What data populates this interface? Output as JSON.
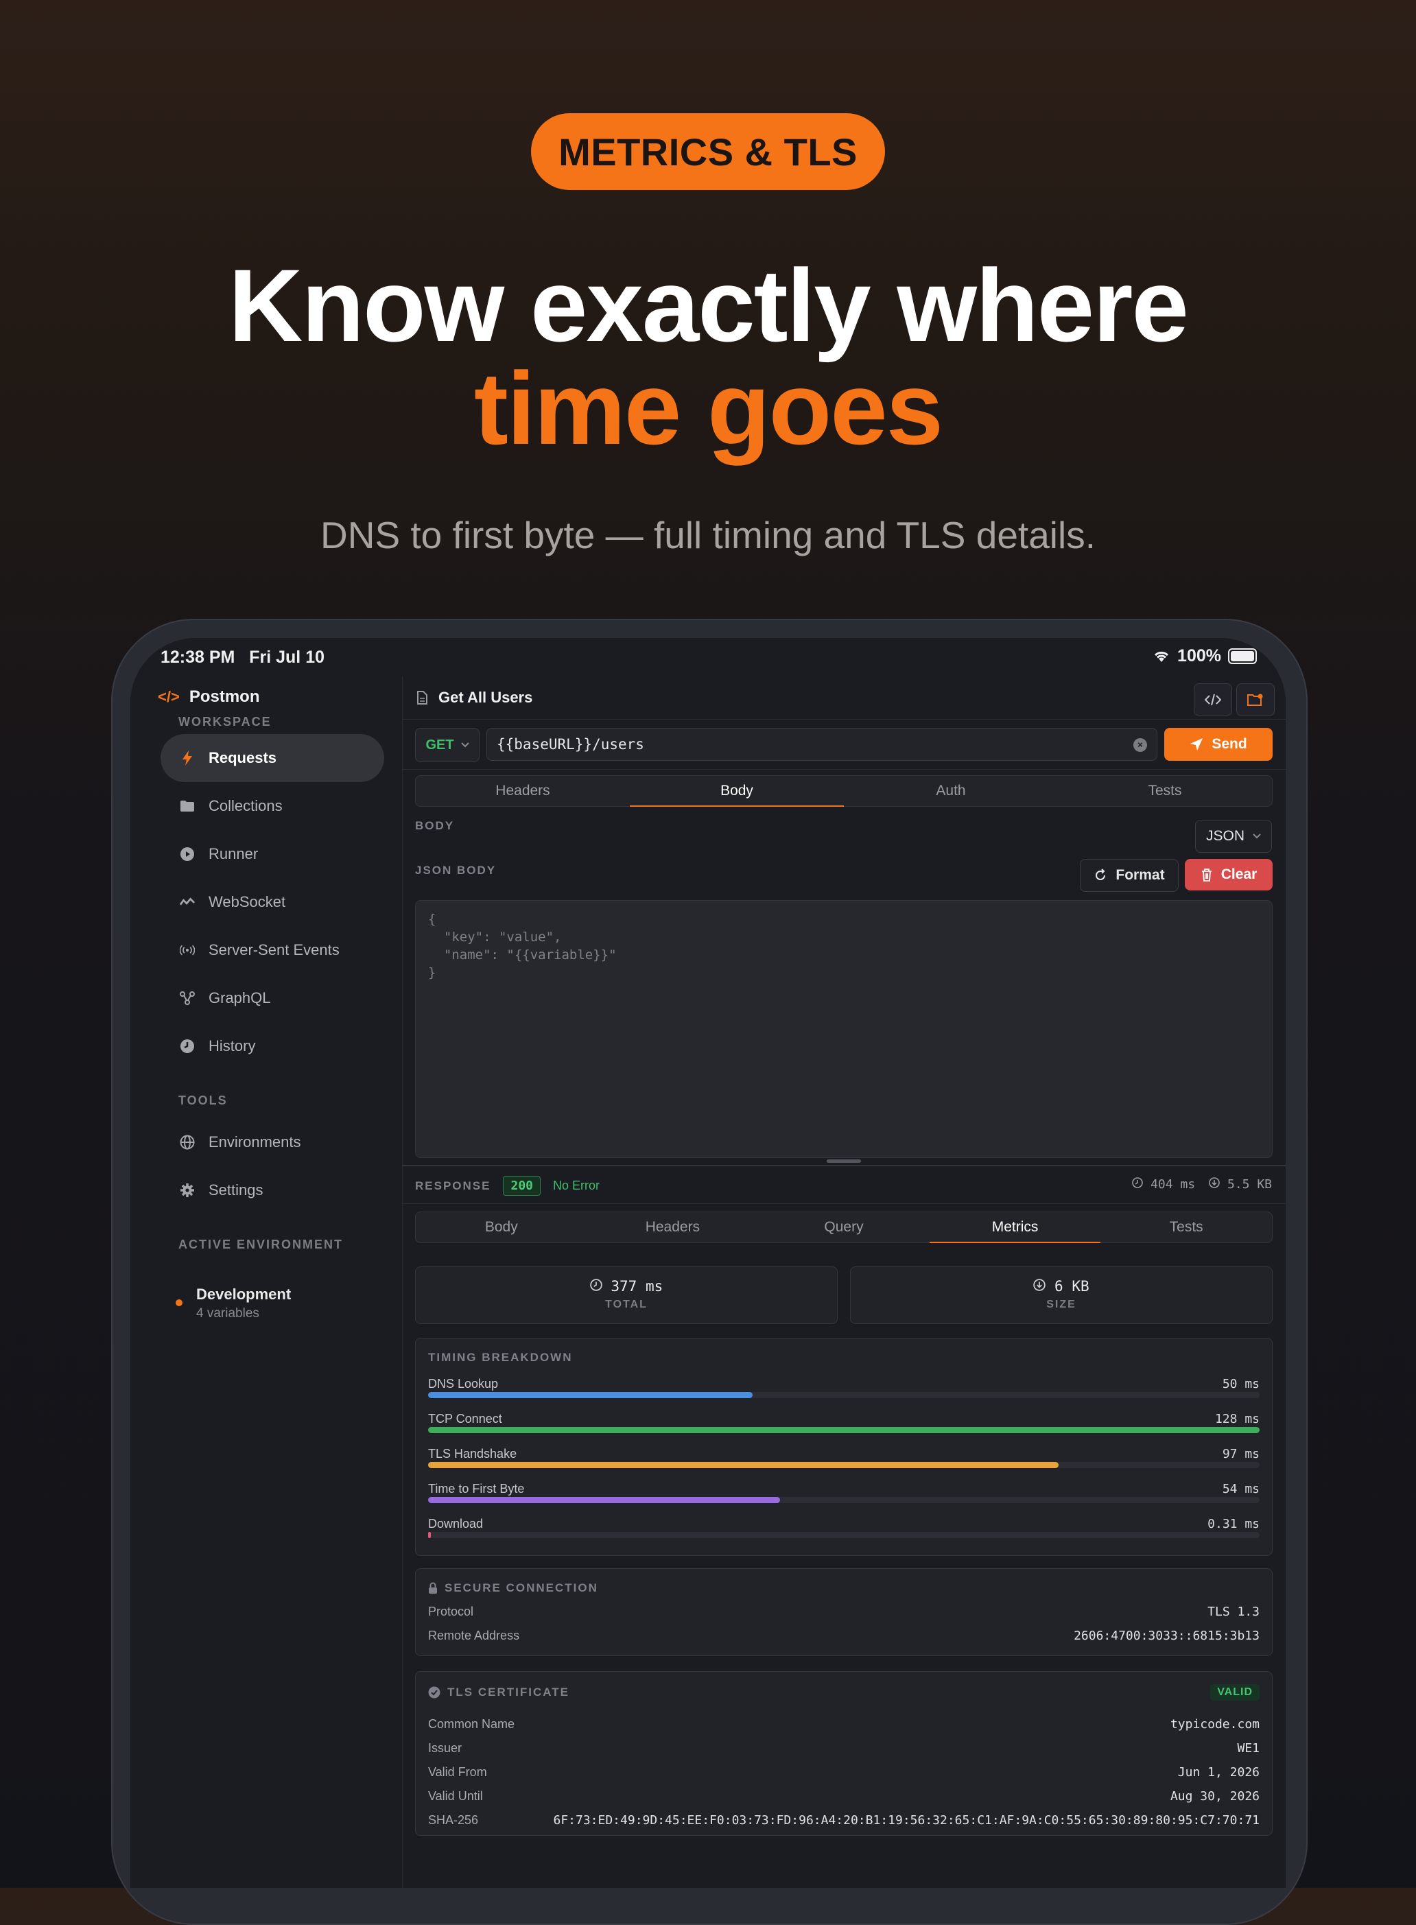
{
  "promo": {
    "badge": "METRICS & TLS",
    "headline_line1": "Know exactly where",
    "headline_line2": "time goes",
    "subtitle": "DNS to first byte — full timing and TLS details."
  },
  "statusbar": {
    "time": "12:38 PM",
    "date": "Fri Jul 10",
    "battery": "100%"
  },
  "app": {
    "name": "Postmon"
  },
  "sidebar": {
    "workspace_label": "WORKSPACE",
    "items": [
      {
        "label": "Requests",
        "icon": "bolt-icon",
        "active": true
      },
      {
        "label": "Collections",
        "icon": "folder-icon"
      },
      {
        "label": "Runner",
        "icon": "play-icon"
      },
      {
        "label": "WebSocket",
        "icon": "wave-icon"
      },
      {
        "label": "Server-Sent Events",
        "icon": "broadcast-icon"
      },
      {
        "label": "GraphQL",
        "icon": "graph-icon"
      },
      {
        "label": "History",
        "icon": "clock-icon"
      }
    ],
    "tools_label": "TOOLS",
    "tools": [
      {
        "label": "Environments",
        "icon": "globe-icon"
      },
      {
        "label": "Settings",
        "icon": "gear-icon"
      }
    ],
    "env_label": "ACTIVE ENVIRONMENT",
    "env_name": "Development",
    "env_vars": "4 variables"
  },
  "request": {
    "title": "Get All Users",
    "method": "GET",
    "url": "{{baseURL}}/users",
    "send_label": "Send",
    "tabs": [
      "Headers",
      "Body",
      "Auth",
      "Tests"
    ],
    "active_tab": "Body",
    "body_label": "BODY",
    "body_type": "JSON",
    "json_body_label": "JSON BODY",
    "format_label": "Format",
    "clear_label": "Clear",
    "json_placeholder": "{\n  \"key\": \"value\",\n  \"name\": \"{{variable}}\"\n}"
  },
  "response": {
    "label": "RESPONSE",
    "status_code": "200",
    "status_text": "No Error",
    "time": "404 ms",
    "size": "5.5 KB",
    "tabs": [
      "Body",
      "Headers",
      "Query",
      "Metrics",
      "Tests"
    ],
    "active_tab": "Metrics",
    "total_value": "377 ms",
    "total_label": "TOTAL",
    "size_value": "6 KB",
    "size_label": "SIZE",
    "timing_title": "TIMING BREAKDOWN",
    "timings": [
      {
        "name": "DNS Lookup",
        "value": "50 ms",
        "fraction": 0.39,
        "color": "#4a8fe0"
      },
      {
        "name": "TCP Connect",
        "value": "128 ms",
        "fraction": 1.0,
        "color": "#3fae5c"
      },
      {
        "name": "TLS Handshake",
        "value": "97 ms",
        "fraction": 0.758,
        "color": "#e8a33a"
      },
      {
        "name": "Time to First Byte",
        "value": "54 ms",
        "fraction": 0.423,
        "color": "#9a6be0"
      },
      {
        "name": "Download",
        "value": "0.31 ms",
        "fraction": 0.003,
        "color": "#e05a78"
      }
    ],
    "secure_title": "SECURE CONNECTION",
    "protocol_label": "Protocol",
    "protocol_value": "TLS 1.3",
    "remote_label": "Remote Address",
    "remote_value": "2606:4700:3033::6815:3b13",
    "cert_title": "TLS CERTIFICATE",
    "cert_status": "VALID",
    "cert_fields": [
      {
        "k": "Common Name",
        "v": "typicode.com"
      },
      {
        "k": "Issuer",
        "v": "WE1"
      },
      {
        "k": "Valid From",
        "v": "Jun 1, 2026"
      },
      {
        "k": "Valid Until",
        "v": "Aug 30, 2026"
      },
      {
        "k": "SHA-256",
        "v": "6F:73:ED:49:9D:45:EE:F0:03:73:FD:96:A4:20:B1:19:56:32:65:C1:AF:9A:C0:55:65:30:89:80:95:C7:70:71"
      }
    ]
  }
}
